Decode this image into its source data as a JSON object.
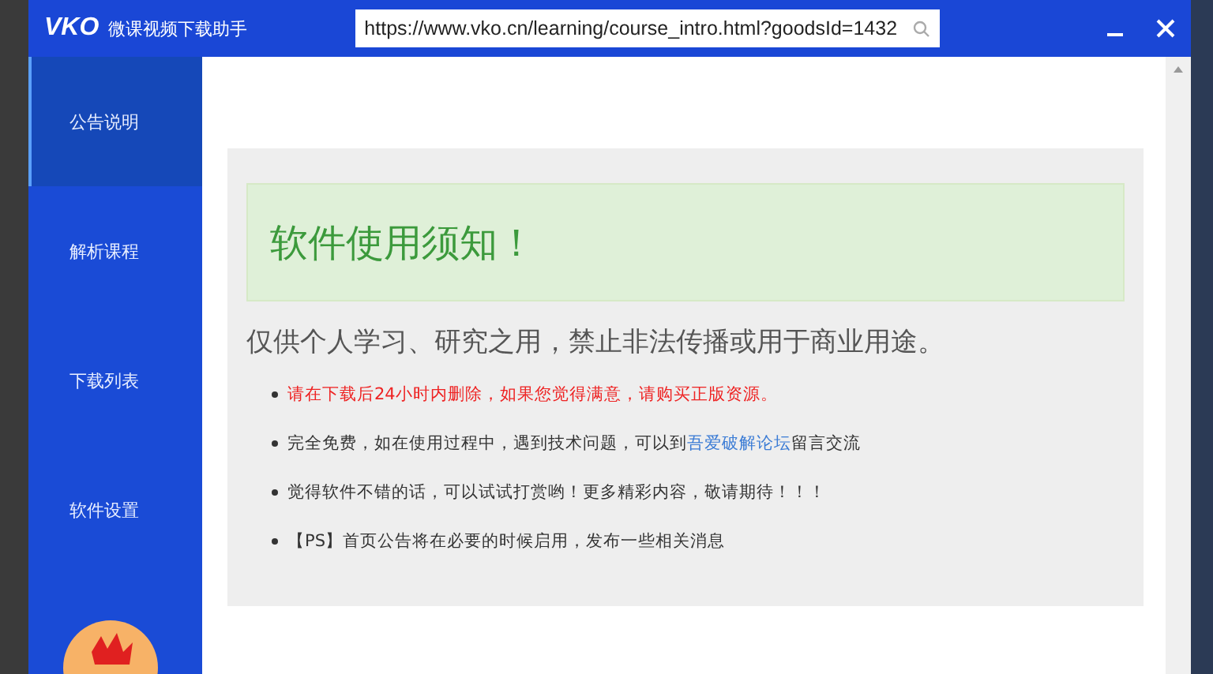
{
  "window": {
    "title": "微课视频下载助手",
    "logo": "VKO"
  },
  "address_bar": {
    "value": "https://www.vko.cn/learning/course_intro.html?goodsId=1432"
  },
  "sidebar": {
    "items": [
      {
        "label": "公告说明",
        "selected": true
      },
      {
        "label": "解析课程",
        "selected": false
      },
      {
        "label": "下载列表",
        "selected": false
      },
      {
        "label": "软件设置",
        "selected": false
      }
    ]
  },
  "notice": {
    "heading": "软件使用须知！",
    "subtitle": "仅供个人学习、研究之用，禁止非法传播或用于商业用途。",
    "items": [
      {
        "kind": "warning",
        "text": "请在下载后24小时内删除，如果您觉得满意，请购买正版资源。"
      },
      {
        "kind": "normal",
        "text": "完全免费，如在使用过程中，遇到技术问题，可以到",
        "link": "吾爱破解论坛",
        "text_after": "留言交流"
      },
      {
        "kind": "normal",
        "text": "觉得软件不错的话，可以试试打赏哟！更多精彩内容，敬请期待！！！"
      },
      {
        "kind": "normal",
        "text": "【PS】首页公告将在必要的时候启用，发布一些相关消息"
      }
    ]
  }
}
